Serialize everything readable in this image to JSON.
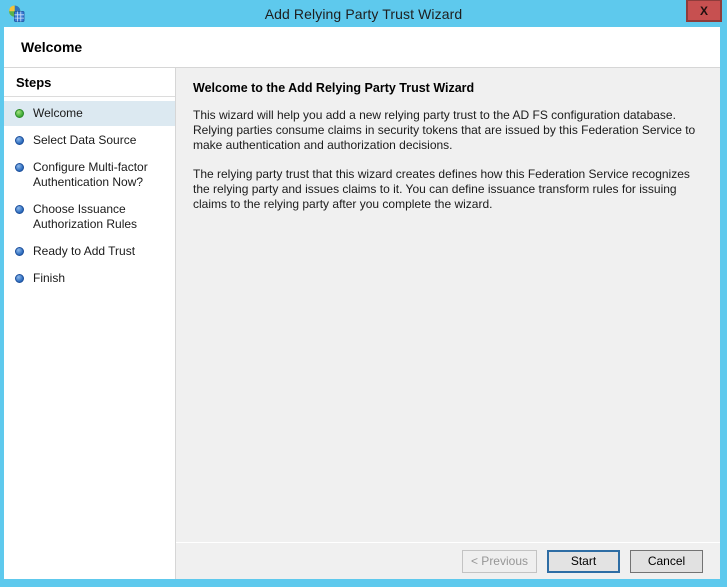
{
  "window": {
    "title": "Add Relying Party Trust Wizard",
    "close_label": "X"
  },
  "header": {
    "title": "Welcome"
  },
  "sidebar": {
    "title": "Steps",
    "steps": [
      {
        "label": "Welcome",
        "state": "active"
      },
      {
        "label": "Select Data Source",
        "state": "pending"
      },
      {
        "label": "Configure Multi-factor Authentication Now?",
        "state": "pending"
      },
      {
        "label": "Choose Issuance Authorization Rules",
        "state": "pending"
      },
      {
        "label": "Ready to Add Trust",
        "state": "pending"
      },
      {
        "label": "Finish",
        "state": "pending"
      }
    ]
  },
  "content": {
    "heading": "Welcome to the Add Relying Party Trust Wizard",
    "paragraphs": [
      "This wizard will help you add a new relying party trust to the AD FS configuration database.  Relying parties consume claims in security tokens that are issued by this Federation Service to make authentication and authorization decisions.",
      "The relying party trust that this wizard creates defines how this Federation Service recognizes the relying party and issues claims to it. You can define issuance transform rules for issuing claims to the relying party after you complete the wizard."
    ]
  },
  "footer": {
    "previous_label": "< Previous",
    "start_label": "Start",
    "cancel_label": "Cancel"
  },
  "colors": {
    "titlebar_blue": "#5ec9ed",
    "close_red": "#c75050",
    "active_step_bg": "#dce9f1",
    "active_dot_green": "#41ae39",
    "pending_dot_blue": "#2f6fc0",
    "focus_border_blue": "#2e6da4"
  }
}
